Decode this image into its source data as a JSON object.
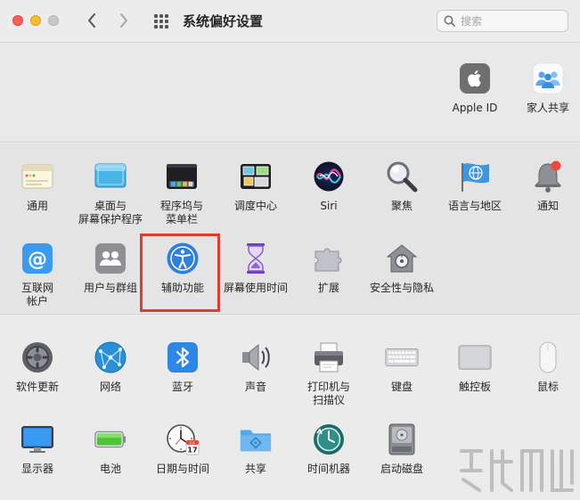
{
  "window": {
    "title": "系统偏好设置"
  },
  "search": {
    "placeholder": "搜索"
  },
  "account_items": [
    {
      "label": "Apple ID",
      "icon": "apple-logo-icon"
    },
    {
      "label": "家人共享",
      "icon": "family-sharing-icon"
    }
  ],
  "panel1": [
    {
      "label": "通用",
      "icon": "general-icon"
    },
    {
      "label": "桌面与\n屏幕保护程序",
      "icon": "desktop-screensaver-icon"
    },
    {
      "label": "程序坞与\n菜单栏",
      "icon": "dock-menubar-icon"
    },
    {
      "label": "调度中心",
      "icon": "mission-control-icon"
    },
    {
      "label": "Siri",
      "icon": "siri-icon"
    },
    {
      "label": "聚焦",
      "icon": "spotlight-icon"
    },
    {
      "label": "语言与地区",
      "icon": "language-region-icon"
    },
    {
      "label": "通知",
      "icon": "notifications-icon"
    },
    {
      "label": "互联网\n帐户",
      "icon": "internet-accounts-icon"
    },
    {
      "label": "用户与群组",
      "icon": "users-groups-icon"
    },
    {
      "label": "辅助功能",
      "icon": "accessibility-icon"
    },
    {
      "label": "屏幕使用时间",
      "icon": "screen-time-icon"
    },
    {
      "label": "扩展",
      "icon": "extensions-icon"
    },
    {
      "label": "安全性与隐私",
      "icon": "security-privacy-icon"
    }
  ],
  "panel2": [
    {
      "label": "软件更新",
      "icon": "software-update-icon"
    },
    {
      "label": "网络",
      "icon": "network-icon"
    },
    {
      "label": "蓝牙",
      "icon": "bluetooth-icon"
    },
    {
      "label": "声音",
      "icon": "sound-icon"
    },
    {
      "label": "打印机与\n扫描仪",
      "icon": "printers-scanners-icon"
    },
    {
      "label": "键盘",
      "icon": "keyboard-icon"
    },
    {
      "label": "触控板",
      "icon": "trackpad-icon"
    },
    {
      "label": "鼠标",
      "icon": "mouse-icon"
    },
    {
      "label": "显示器",
      "icon": "displays-icon"
    },
    {
      "label": "电池",
      "icon": "battery-icon"
    },
    {
      "label": "日期与时间",
      "icon": "date-time-icon"
    },
    {
      "label": "共享",
      "icon": "sharing-icon"
    },
    {
      "label": "时间机器",
      "icon": "time-machine-icon"
    },
    {
      "label": "启动磁盘",
      "icon": "startup-disk-icon"
    }
  ],
  "calendar_icon": {
    "month": "JUL",
    "day": "17"
  },
  "colors": {
    "highlight": "#e23a2e"
  }
}
